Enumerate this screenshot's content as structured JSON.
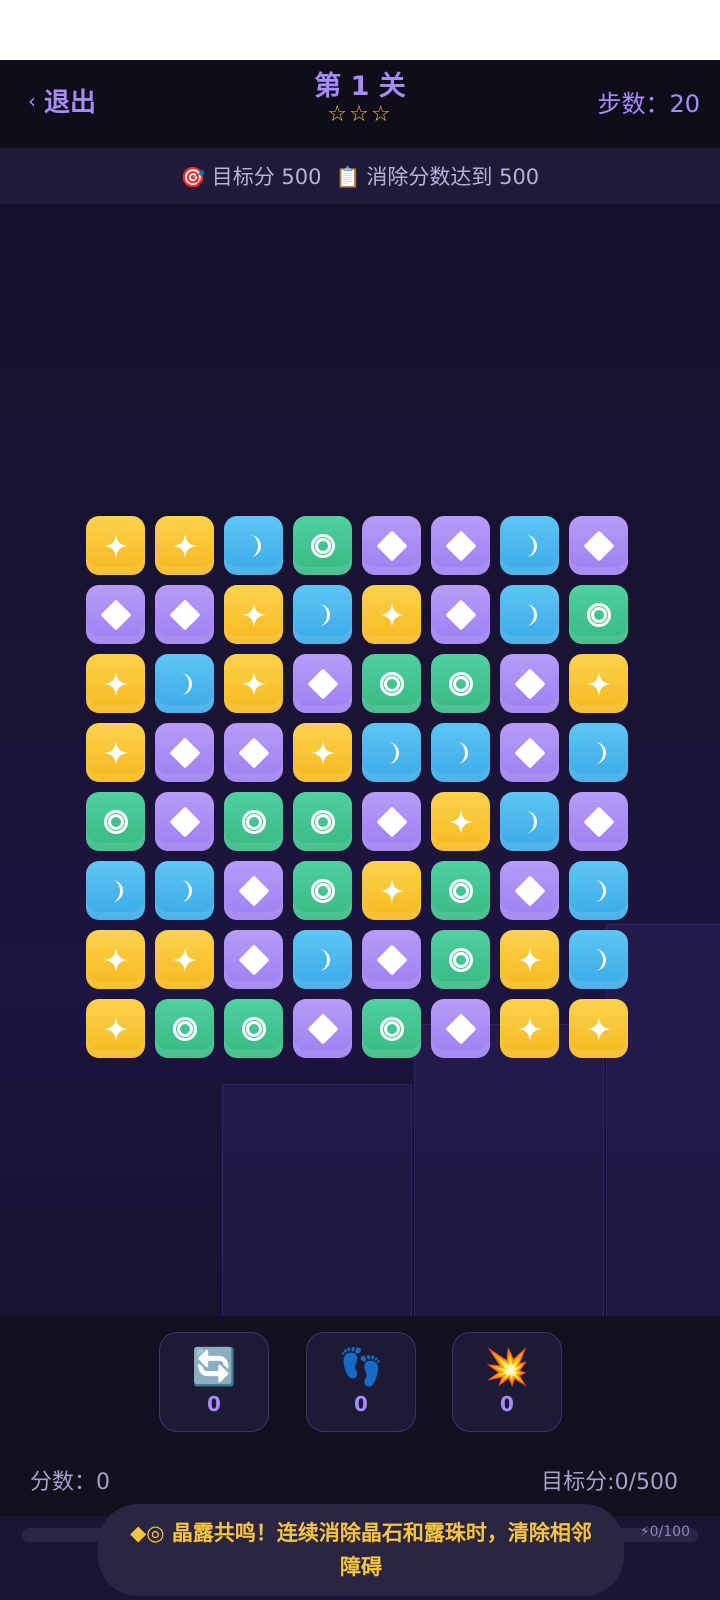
{
  "header": {
    "exit_label": "退出",
    "exit_chevron": "‹",
    "level_title": "第 1 关",
    "stars": "☆☆☆",
    "steps": "步数：20"
  },
  "goal": {
    "target_icon": "🎯",
    "target_text": "目标分 500",
    "task_icon": "📋",
    "task_text": "消除分数达到 500"
  },
  "board": {
    "rows": [
      [
        "star",
        "star",
        "moon",
        "ring",
        "diamond",
        "diamond",
        "moon",
        "diamond"
      ],
      [
        "diamond",
        "diamond",
        "star",
        "moon",
        "star",
        "diamond",
        "moon",
        "ring"
      ],
      [
        "star",
        "moon",
        "star",
        "diamond",
        "ring",
        "ring",
        "diamond",
        "star"
      ],
      [
        "star",
        "diamond",
        "diamond",
        "star",
        "moon",
        "moon",
        "diamond",
        "moon"
      ],
      [
        "ring",
        "diamond",
        "ring",
        "ring",
        "diamond",
        "star",
        "moon",
        "diamond"
      ],
      [
        "moon",
        "moon",
        "diamond",
        "ring",
        "star",
        "ring",
        "diamond",
        "moon"
      ],
      [
        "star",
        "star",
        "diamond",
        "moon",
        "diamond",
        "ring",
        "star",
        "moon"
      ],
      [
        "star",
        "ring",
        "ring",
        "diamond",
        "ring",
        "diamond",
        "star",
        "star"
      ]
    ],
    "colors": {
      "star": "#f5b81f",
      "moon": "#3aa9e6",
      "ring": "#37b884",
      "diamond": "#9d7ff0"
    }
  },
  "tools": [
    {
      "icon": "🔄",
      "name": "shuffle-icon",
      "count": "0"
    },
    {
      "icon": "👣",
      "name": "footprints-icon",
      "count": "0"
    },
    {
      "icon": "💥",
      "name": "explosion-icon",
      "count": "0"
    }
  ],
  "status": {
    "score": "分数：0",
    "target": "目标分:0/500"
  },
  "energy": {
    "text": "⚡0/100",
    "value": 0
  },
  "hint": "◆◎ 晶露共鸣！连续消除晶石和露珠时，清除相邻障碍"
}
